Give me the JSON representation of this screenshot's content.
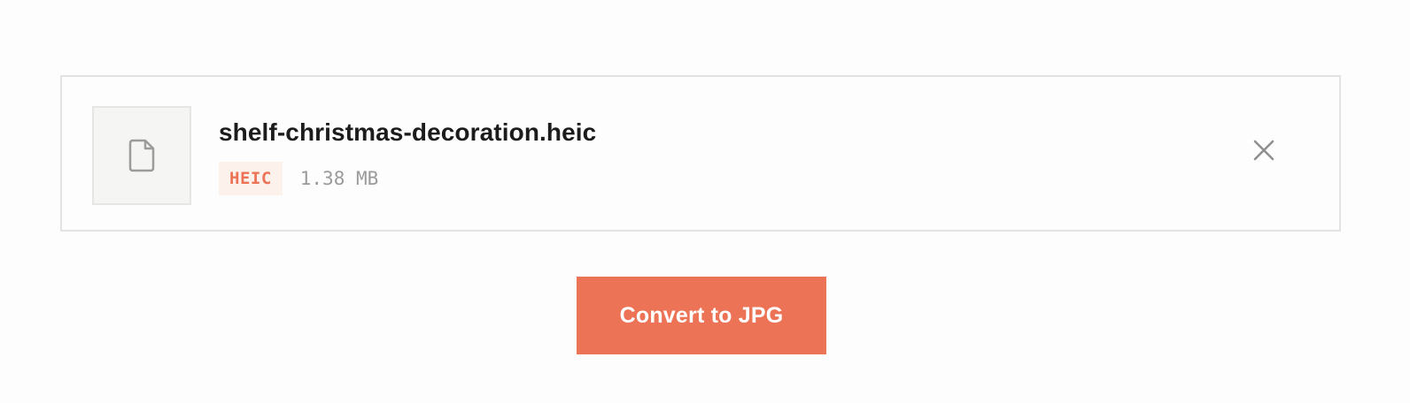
{
  "file": {
    "name": "shelf-christmas-decoration.heic",
    "type_badge": "HEIC",
    "size": "1.38 MB",
    "thumbnail_icon": "document-icon",
    "remove_icon": "close-icon"
  },
  "actions": {
    "convert_label": "Convert to JPG"
  },
  "colors": {
    "accent": "#ec7355",
    "badge_bg": "#fdf1ec",
    "badge_text": "#ec7356",
    "border": "#e3e3e3",
    "thumb_bg": "#f5f5f3",
    "muted_text": "#9a9a9a",
    "title_text": "#1c1c1c"
  }
}
